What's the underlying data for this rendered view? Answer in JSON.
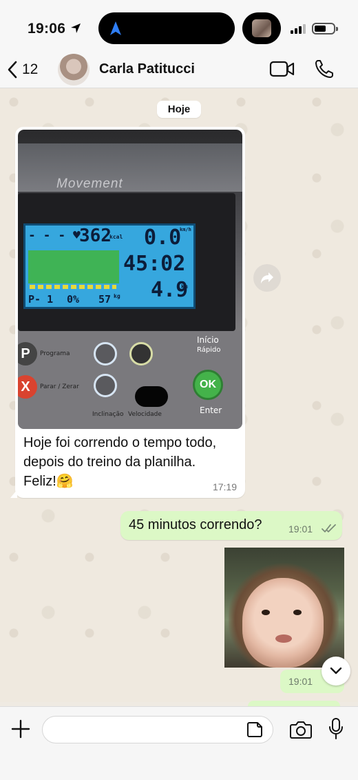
{
  "status_bar": {
    "time": "19:06",
    "location_icon": "location-arrow-icon",
    "island_icon": "navigation-arrow-icon",
    "signal_icon": "cellular-signal-icon",
    "battery_icon": "battery-icon",
    "battery_level": 0.5
  },
  "header": {
    "back_count": "12",
    "contact_name": "Carla Patitucci",
    "icons": [
      "chevron-left-icon",
      "video-call-icon",
      "phone-call-icon"
    ]
  },
  "chat": {
    "date_label": "Hoje",
    "incoming_photo": {
      "brand": "Movement",
      "display": {
        "heart_row": "- - - ♥",
        "kcal": "362",
        "kcal_unit": "kcal",
        "speed": "0.0",
        "speed_unit": "km/h",
        "time": "45:02",
        "distance": "4.9",
        "distance_unit": "km",
        "program": "P- 1",
        "incline": "0%",
        "weight": "57",
        "weight_unit": "kg"
      },
      "keys": {
        "programa": "Programa",
        "parar": "Parar / Zerar",
        "inclinacao": "Inclinação",
        "velocidade": "Velocidade",
        "inicio": "Início",
        "rapido": "Rápido",
        "ok": "OK",
        "enter": "Enter"
      }
    },
    "incoming_text": "Hoje foi correndo o tempo todo, depois do treino da planilha. Feliz!🤗",
    "incoming_time": "17:19",
    "outgoing_text": "45 minutos correndo?",
    "outgoing_time": "19:01",
    "outgoing_photo_time": "19:01",
    "accent_colors": {
      "outgoing_bubble": "#dcf8c6",
      "incoming_bubble": "#ffffff",
      "read_ticks": "#7b8b79"
    }
  },
  "input_bar": {
    "placeholder": "",
    "icons": [
      "plus-icon",
      "sticker-icon",
      "camera-icon",
      "microphone-icon"
    ]
  }
}
